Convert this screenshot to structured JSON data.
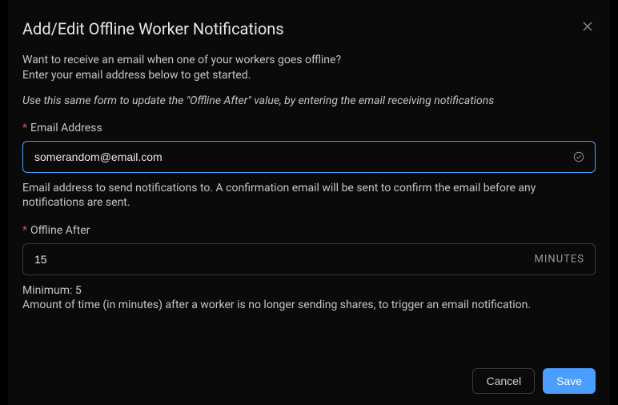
{
  "modal": {
    "title": "Add/Edit Offline Worker Notifications",
    "intro_line1": "Want to receive an email when one of your workers goes offline?",
    "intro_line2": "Enter your email address below to get started.",
    "hint": "Use this same form to update the \"Offline After\" value, by entering the email receiving notifications"
  },
  "email": {
    "label": "Email Address",
    "value": "somerandom@email.com",
    "help": "Email address to send notifications to. A confirmation email will be sent to confirm the email before any notifications are sent."
  },
  "offline_after": {
    "label": "Offline After",
    "value": "15",
    "suffix": "MINUTES",
    "minimum_label": "Minimum: 5",
    "help": "Amount of time (in minutes) after a worker is no longer sending shares, to trigger an email notification."
  },
  "buttons": {
    "cancel": "Cancel",
    "save": "Save"
  }
}
